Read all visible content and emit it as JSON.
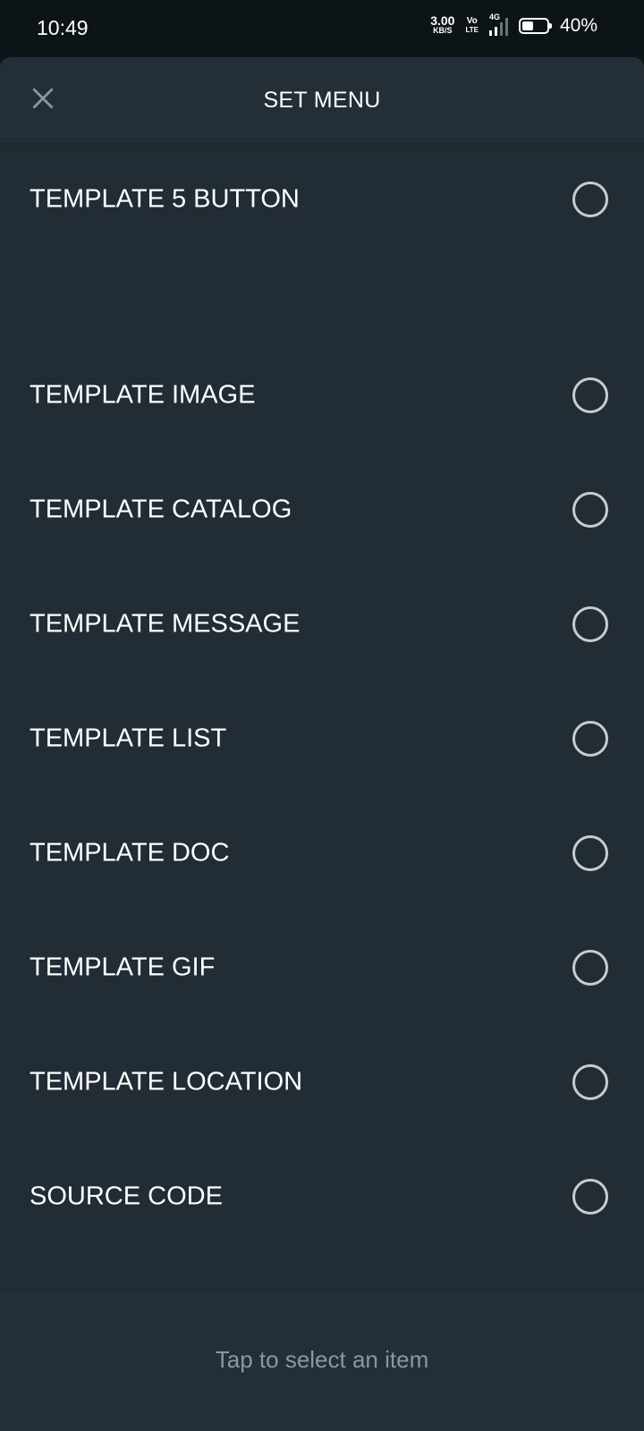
{
  "status_bar": {
    "time": "10:49",
    "net_speed_value": "3.00",
    "net_speed_unit": "KB/S",
    "volte_top": "Vo",
    "volte_bottom": "LTE",
    "network_type": "4G",
    "battery_percent": "40%",
    "battery_level": 0.4
  },
  "header": {
    "title": "SET MENU",
    "close_icon": "close-icon"
  },
  "menu": {
    "items": [
      {
        "label": "TEMPLATE 5 BUTTON",
        "selected": false
      },
      {
        "label": "TEMPLATE IMAGE",
        "selected": false
      },
      {
        "label": "TEMPLATE CATALOG",
        "selected": false
      },
      {
        "label": "TEMPLATE MESSAGE",
        "selected": false
      },
      {
        "label": "TEMPLATE LIST",
        "selected": false
      },
      {
        "label": "TEMPLATE DOC",
        "selected": false
      },
      {
        "label": "TEMPLATE GIF",
        "selected": false
      },
      {
        "label": "TEMPLATE LOCATION",
        "selected": false
      },
      {
        "label": "SOURCE CODE",
        "selected": false
      }
    ]
  },
  "footer": {
    "hint": "Tap to select an item"
  },
  "colors": {
    "sheet_background": "#212c34",
    "header_background": "#232e36",
    "status_background": "#0d1418",
    "text_primary": "#ffffff",
    "text_secondary": "#8b979e",
    "radio_border": "#c8ccce"
  }
}
